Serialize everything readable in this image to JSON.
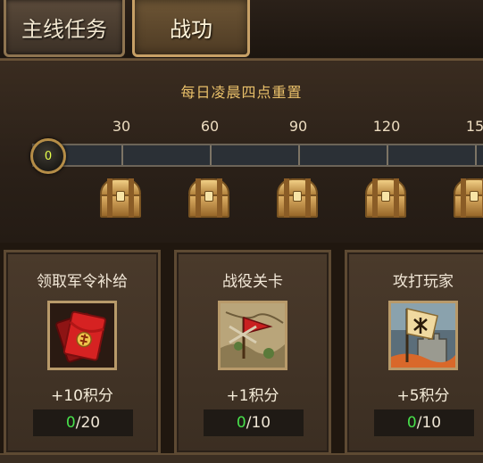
{
  "tabs": [
    {
      "label": "主线任务",
      "active": false
    },
    {
      "label": "战功",
      "active": true
    }
  ],
  "reset_note": "每日凌晨四点重置",
  "progress": {
    "current": "0",
    "ticks": [
      "30",
      "60",
      "90",
      "120",
      "15"
    ]
  },
  "chests": [
    "chest-icon",
    "chest-icon",
    "chest-icon",
    "chest-icon",
    "chest-icon"
  ],
  "tasks": [
    {
      "title": "领取军令补给",
      "icon": "red-envelope-icon",
      "reward": "+10积分",
      "done": "0",
      "total": "/20"
    },
    {
      "title": "战役关卡",
      "icon": "battle-map-icon",
      "reward": "+1积分",
      "done": "0",
      "total": "/10"
    },
    {
      "title": "攻打玩家",
      "icon": "attack-castle-icon",
      "reward": "+5积分",
      "done": "0",
      "total": "/10"
    }
  ],
  "colors": {
    "accent_gold": "#e9c06a",
    "progress_done_green": "#47e04b",
    "knob_value": "#e6ff4a"
  }
}
